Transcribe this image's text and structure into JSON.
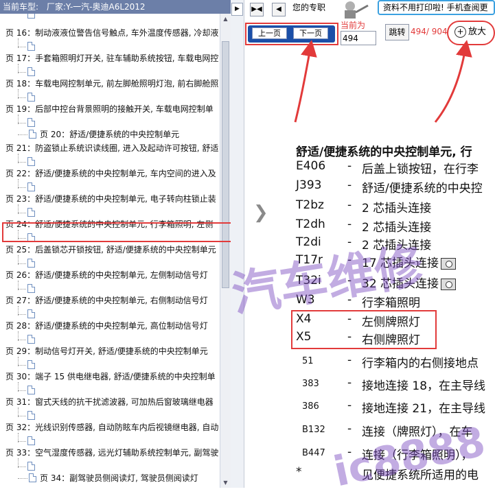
{
  "sidebar": {
    "header_label": "当前车型:",
    "header_model": "厂家:Y-一汽-奥迪A6L2012",
    "items": [
      {
        "label": "页 16：制动液液位警告信号触点, 车外温度传感器, 冷却液",
        "level": 0
      },
      {
        "label": "页 17：手套箱照明灯开关, 驻车辅助系统按钮, 车载电网控",
        "level": 0
      },
      {
        "label": "页 18：车载电网控制单元, 前左脚舱照明灯泡, 前右脚舱照",
        "level": 0
      },
      {
        "label": "页 19：后部中控台背景照明的接触开关, 车载电网控制单",
        "level": 0
      },
      {
        "label": "页 20：舒适/便捷系统的中央控制单元",
        "level": 1
      },
      {
        "label": "页 21：防盗锁止系统识读线圈, 进入及起动许可按钮, 舒适",
        "level": 0
      },
      {
        "label": "页 22：舒适/便捷系统的中央控制单元, 车内空间的进入及",
        "level": 0
      },
      {
        "label": "页 23：舒适/便捷系统的中央控制单元, 电子转向柱锁止装",
        "level": 0
      },
      {
        "label": "页 24：舒适/便捷系统的中央控制单元, 行李箱照明, 左侧",
        "level": 0,
        "selected": true
      },
      {
        "label": "页 25：后盖锁芯开锁按钮, 舒适/便捷系统的中央控制单元",
        "level": 0
      },
      {
        "label": "页 26：舒适/便捷系统的中央控制单元, 左侧制动信号灯",
        "level": 0
      },
      {
        "label": "页 27：舒适/便捷系统的中央控制单元, 右侧制动信号灯",
        "level": 0
      },
      {
        "label": "页 28：舒适/便捷系统的中央控制单元, 高位制动信号灯",
        "level": 0
      },
      {
        "label": "页 29：制动信号灯开关, 舒适/便捷系统的中央控制单元",
        "level": 0
      },
      {
        "label": "页 30：端子 15 供电继电器, 舒适/便捷系统的中央控制单",
        "level": 0
      },
      {
        "label": "页 31：窗式天线的抗干扰滤波器, 可加热后窗玻璃继电器",
        "level": 0
      },
      {
        "label": "页 32：光线识别传感器, 自动防眩车内后视镜继电器, 自动",
        "level": 0
      },
      {
        "label": "页 33：空气湿度传感器, 远光灯辅助系统控制单元, 副驾驶",
        "level": 0
      },
      {
        "label": "页 34：副驾驶员侧阅读灯, 驾驶员侧阅读灯",
        "level": 1
      }
    ]
  },
  "toolbar": {
    "ad_text": "您的专职",
    "banner_text": "资料不用打印啦! 手机查阅更"
  },
  "nav": {
    "prev_label": "上一页",
    "next_label": "下一页",
    "current_label": "当前为",
    "current_page": "494",
    "go_label": "跳转",
    "page_count": "494/ 904",
    "zoom_label": "放大"
  },
  "document": {
    "title": "舒适/便捷系统的中央控制单元, 行",
    "entries": [
      {
        "code": "E406",
        "desc": "后盖上锁按钮，在行李"
      },
      {
        "code": "J393",
        "desc": "舒适/便捷系统的中央控"
      },
      {
        "code": "T2bz",
        "desc": "2 芯插头连接"
      },
      {
        "code": "T2dh",
        "desc": "2 芯插头连接"
      },
      {
        "code": "T2di",
        "desc": "2 芯插头连接"
      },
      {
        "code": "T17r",
        "desc": "17 芯插头连接"
      },
      {
        "code": "T32i",
        "desc": "32 芯插头连接"
      },
      {
        "code": "W3",
        "desc": "行李箱照明"
      },
      {
        "code": "X4",
        "desc": "左侧牌照灯"
      },
      {
        "code": "X5",
        "desc": "右侧牌照灯"
      },
      {
        "code": "51",
        "desc": "行李箱内的右侧接地点"
      },
      {
        "code": "383",
        "desc": "接地连接 18，在主导线"
      },
      {
        "code": "386",
        "desc": "接地连接 21，在主导线"
      },
      {
        "code": "B132",
        "desc": "连接（牌照灯），在车"
      },
      {
        "code": "B447",
        "desc": "连接（行李箱照明），"
      },
      {
        "code": "*",
        "desc": "见便捷系统所适用的电"
      }
    ]
  },
  "watermark": {
    "line1": "汽车维修",
    "line2": "ic8888"
  },
  "colors": {
    "highlight": "#e23a3a",
    "nav_blue": "#1b4fa8",
    "sidebar_header": "#6c7fa8",
    "watermark": "#7846be"
  }
}
